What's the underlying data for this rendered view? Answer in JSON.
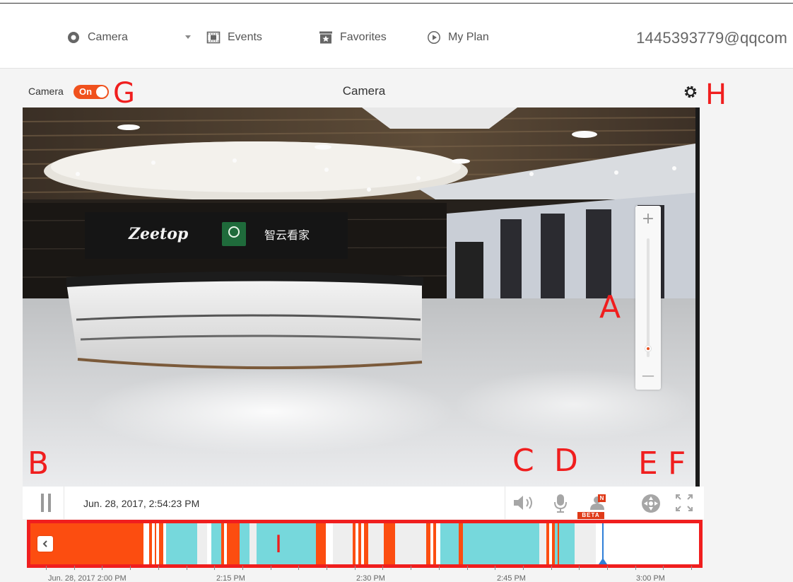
{
  "nav": {
    "items": [
      {
        "label": "Camera",
        "icon": "camera-icon"
      },
      {
        "label": "Events",
        "icon": "events-icon"
      },
      {
        "label": "Favorites",
        "icon": "favorites-icon"
      },
      {
        "label": "My Plan",
        "icon": "play-icon"
      }
    ],
    "account": "1445393779@qqcom"
  },
  "panel": {
    "camera_toggle_label": "Camera",
    "camera_toggle_state": "On",
    "title": "Camera"
  },
  "video": {
    "signage_brand": "Zeetop",
    "signage_cn": "智云看家",
    "zoom_plus": "+",
    "zoom_minus": "—",
    "zoom_level": 0.05
  },
  "controls": {
    "timestamp": "Jun. 28, 2017, 2:54:23 PM",
    "beta_label": "BETA",
    "new_badge": "N"
  },
  "annotations": {
    "a": "A",
    "b": "B",
    "c": "C",
    "d": "D",
    "e": "E",
    "f": "F",
    "g": "G",
    "h": "H",
    "i": "I"
  },
  "timeline": {
    "axis_labels": [
      "Jun. 28, 2017 2:00 PM",
      "2:15 PM",
      "2:30 PM",
      "2:45 PM",
      "3:00 PM"
    ],
    "colors": {
      "recorded": "#fc4d10",
      "event": "#76d8dc",
      "gap": "#ffffff",
      "light": "#eeeeee",
      "playhead": "#2f7fd8"
    }
  },
  "colors": {
    "accent": "#f0511d",
    "annotation": "#f01e1e"
  }
}
